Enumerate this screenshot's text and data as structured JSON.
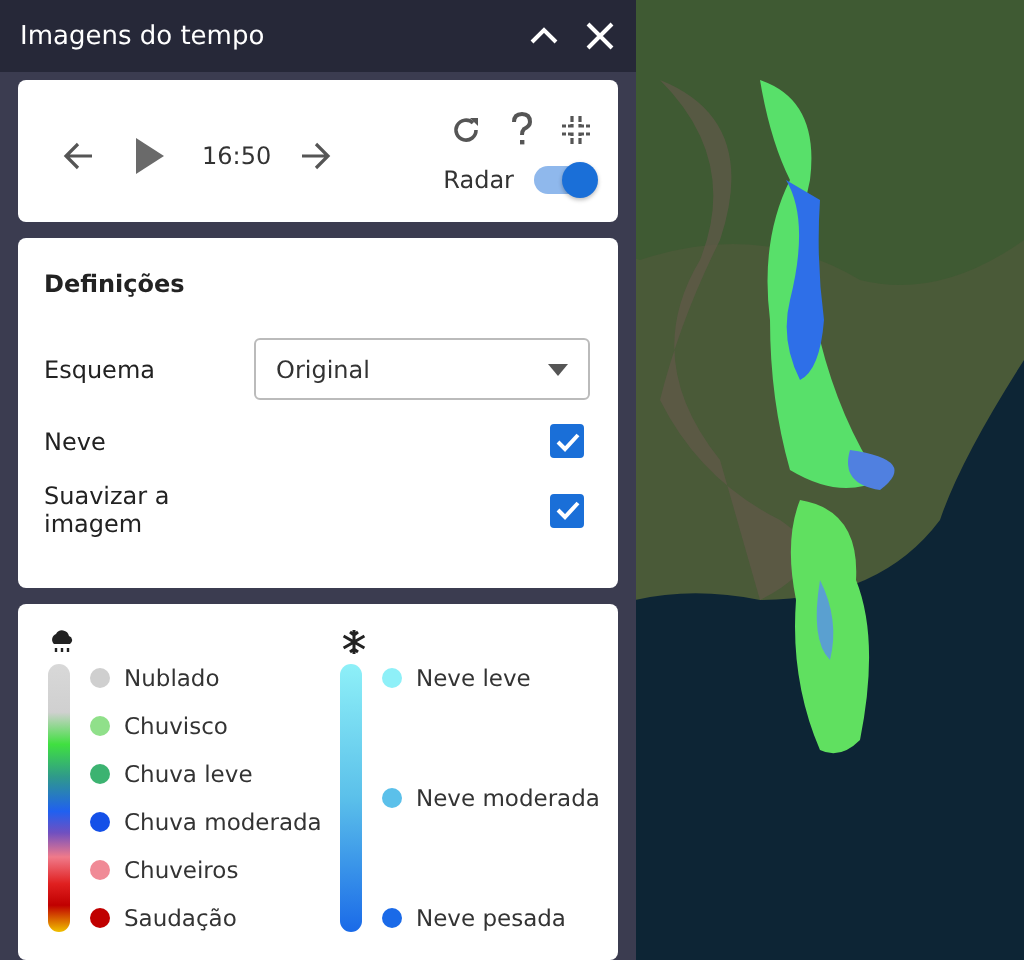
{
  "window": {
    "title": "Imagens do tempo"
  },
  "player": {
    "time": "16:50",
    "radar_label": "Radar",
    "radar_on": true
  },
  "settings": {
    "title": "Definições",
    "scheme_label": "Esquema",
    "scheme_value": "Original",
    "rows": [
      {
        "label": "Neve",
        "checked": true
      },
      {
        "label": "Suavizar a imagem",
        "checked": true
      }
    ]
  },
  "legend": {
    "rain": [
      {
        "label": "Nublado",
        "color": "#cfcfcf"
      },
      {
        "label": "Chuvisco",
        "color": "#90e08a"
      },
      {
        "label": "Chuva leve",
        "color": "#3cb371"
      },
      {
        "label": "Chuva moderada",
        "color": "#1450e8"
      },
      {
        "label": "Chuveiros",
        "color": "#f08a96"
      },
      {
        "label": "Saudação",
        "color": "#c00000"
      }
    ],
    "snow": [
      {
        "label": "Neve leve",
        "color": "#8ef0f8"
      },
      {
        "label": "Neve moderada",
        "color": "#5bc0ea"
      },
      {
        "label": "Neve pesada",
        "color": "#1a6ae8"
      }
    ]
  }
}
